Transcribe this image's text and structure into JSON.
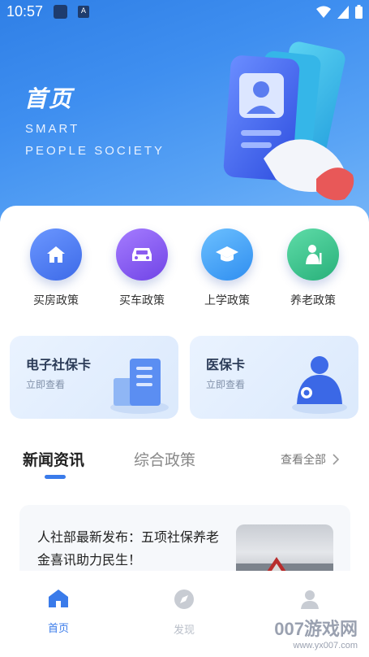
{
  "status_bar": {
    "time": "10:57",
    "small_badge": "A"
  },
  "hero": {
    "title": "首页",
    "subtitle_line1": "SMART",
    "subtitle_line2": "PEOPLE SOCIETY"
  },
  "categories": [
    {
      "label": "买房政策",
      "icon": "house-icon",
      "color": "#4f7ff0"
    },
    {
      "label": "买车政策",
      "icon": "car-icon",
      "color": "#8a5cf0"
    },
    {
      "label": "上学政策",
      "icon": "graduation-cap-icon",
      "color": "#3ea0f5"
    },
    {
      "label": "养老政策",
      "icon": "elderly-icon",
      "color": "#3cc38d"
    }
  ],
  "cards": [
    {
      "title": "电子社保卡",
      "subtitle": "立即查看"
    },
    {
      "title": "医保卡",
      "subtitle": "立即查看"
    }
  ],
  "tabs": {
    "active": "新闻资讯",
    "other": "综合政策",
    "view_all": "查看全部"
  },
  "news": [
    {
      "title": "人社部最新发布：五项社保养老金喜讯助力民生！"
    }
  ],
  "nav": [
    {
      "label": "首页",
      "icon": "home-icon",
      "active": true
    },
    {
      "label": "发现",
      "icon": "compass-icon",
      "active": false
    },
    {
      "label": "",
      "icon": "user-icon",
      "active": false
    }
  ],
  "watermark": {
    "main": "007游戏网",
    "sub": "www.yx007.com"
  },
  "colors": {
    "accent": "#3a7bea",
    "hero_bg": "#3f8ff0",
    "inactive": "#b8bec8"
  }
}
